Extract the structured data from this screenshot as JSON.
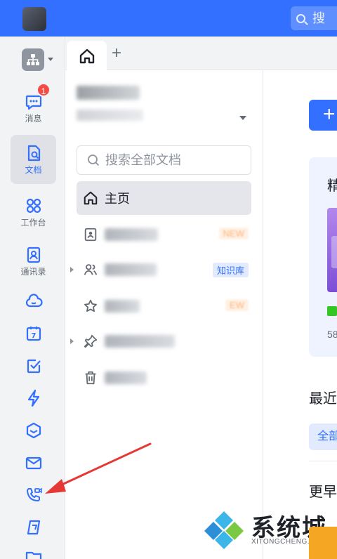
{
  "topbar": {
    "search_placeholder": "搜"
  },
  "sidebar": {
    "items": [
      {
        "label": "消息",
        "icon": "message-icon",
        "badge": "1"
      },
      {
        "label": "文档",
        "icon": "doc-icon",
        "active": true
      },
      {
        "label": "工作台",
        "icon": "grid-icon"
      },
      {
        "label": "通讯录",
        "icon": "contacts-icon"
      },
      {
        "label": "",
        "icon": "cloud-icon"
      },
      {
        "label": "",
        "icon": "calendar-icon",
        "glyph": "7"
      },
      {
        "label": "",
        "icon": "checkbox-icon"
      },
      {
        "label": "",
        "icon": "lightning-icon"
      },
      {
        "label": "",
        "icon": "cube-icon"
      },
      {
        "label": "",
        "icon": "mail-icon"
      },
      {
        "label": "",
        "icon": "video-call-icon"
      },
      {
        "label": "",
        "icon": "wiki-icon"
      },
      {
        "label": "",
        "icon": "folder-icon"
      }
    ]
  },
  "panel": {
    "search_placeholder": "搜索全部文档",
    "home_label": "主页",
    "rows": [
      {
        "icon": "contact-card-icon",
        "tag": "NEW"
      },
      {
        "icon": "people-icon",
        "tag": "知识库"
      },
      {
        "icon": "star-icon",
        "tag": "EW"
      },
      {
        "icon": "pin-icon"
      },
      {
        "icon": "trash-icon"
      }
    ]
  },
  "main": {
    "new_button": "+",
    "card_title": "精",
    "card_number": "58",
    "recent_title": "最近",
    "tab_all": "全部",
    "earlier_title": "更早"
  },
  "watermark": {
    "name": "系统城",
    "url": "XITONGCHENG.COM"
  },
  "colors": {
    "accent": "#3370ff",
    "annotation_arrow": "#e53935",
    "badge": "#f54a45"
  }
}
